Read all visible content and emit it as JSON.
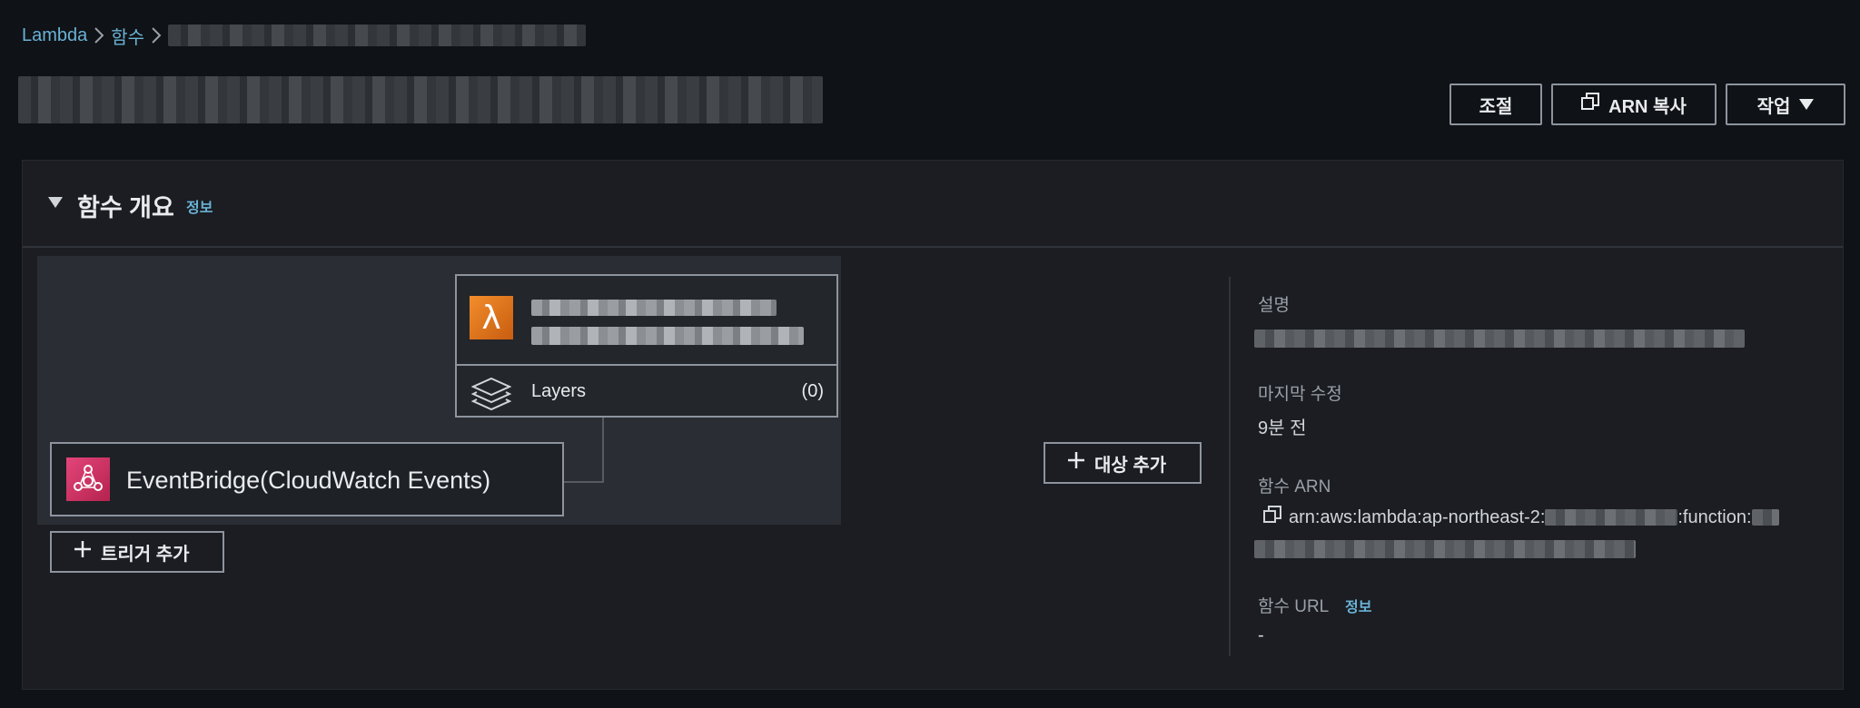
{
  "breadcrumb": {
    "root": "Lambda",
    "functions": "함수"
  },
  "header": {
    "throttle_label": "조절",
    "copy_arn_label": "ARN 복사",
    "actions_label": "작업"
  },
  "overview": {
    "title": "함수 개요",
    "info_link": "정보",
    "function_card": {
      "icon": "lambda-icon",
      "layers_label": "Layers",
      "layers_count": "(0)"
    },
    "trigger": {
      "label": "EventBridge(CloudWatch Events)",
      "icon": "eventbridge-icon"
    },
    "add_trigger_label": "트리거 추가",
    "add_destination_label": "대상 추가",
    "details": {
      "description_label": "설명",
      "last_modified_label": "마지막 수정",
      "last_modified_value": "9분 전",
      "arn_label": "함수 ARN",
      "arn_prefix": "arn:aws:lambda:ap-northeast-2:",
      "arn_mid": ":function:",
      "url_label": "함수 URL",
      "url_info_link": "정보",
      "url_value": "-"
    }
  },
  "colors": {
    "background": "#0f1216",
    "panel": "#1b1d22",
    "link": "#6ab2d6",
    "lambda_orange": "#f28d2b",
    "eventbridge_pink": "#e3457a"
  }
}
